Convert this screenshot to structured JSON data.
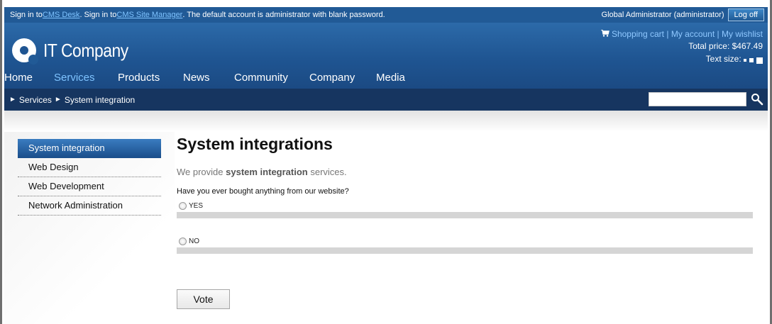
{
  "topbar": {
    "sign_in_prefix": "Sign in to ",
    "cms_desk": "CMS Desk",
    "sign_in_mid": ". Sign in to ",
    "site_manager": "CMS Site Manager",
    "suffix": ". The default account is administrator with blank password.",
    "user": "Global Administrator (administrator)",
    "logoff": "Log off"
  },
  "header": {
    "logo_text": "IT Company",
    "shopping_cart": "Shopping cart",
    "my_account": "My account",
    "my_wishlist": "My wishlist",
    "sep": "|",
    "total_price": "Total price: $467.49",
    "text_size": "Text size:"
  },
  "nav": {
    "items": [
      "Home",
      "Services",
      "Products",
      "News",
      "Community",
      "Company",
      "Media"
    ],
    "active": "Services"
  },
  "breadcrumb": {
    "arrow": "►",
    "items": [
      "Services",
      "System integration"
    ]
  },
  "search": {
    "value": ""
  },
  "sidemenu": {
    "items": [
      "System integration",
      "Web Design",
      "Web Development",
      "Network Administration"
    ],
    "active": "System integration"
  },
  "main": {
    "title": "System integrations",
    "intro_prefix": "We provide ",
    "intro_bold": "system integration",
    "intro_suffix": " services.",
    "question": "Have you ever bought anything from our website?",
    "options": [
      {
        "label": "YES",
        "fraction": 0
      },
      {
        "label": "NO",
        "fraction": 0
      }
    ],
    "vote": "Vote"
  },
  "colors": {
    "header_blue": "#1f5592",
    "breadcrumb_bar": "#163560",
    "link_blue": "#7ec3ff"
  }
}
